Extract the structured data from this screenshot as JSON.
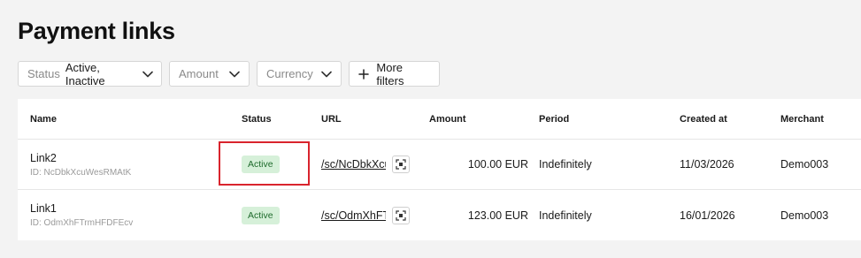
{
  "page": {
    "title": "Payment links"
  },
  "filters": {
    "status": {
      "label": "Status",
      "value": "Active, Inactive",
      "icon": "chevron-down-icon"
    },
    "amount": {
      "label": "Amount",
      "icon": "chevron-down-icon"
    },
    "currency": {
      "label": "Currency",
      "icon": "chevron-down-icon"
    },
    "more": {
      "label": "More filters",
      "icon": "plus-icon"
    }
  },
  "table": {
    "headers": {
      "name": "Name",
      "status": "Status",
      "url": "URL",
      "amount": "Amount",
      "period": "Period",
      "created": "Created at",
      "merchant": "Merchant"
    },
    "rows": [
      {
        "name": "Link2",
        "id": "ID: NcDbkXcuWesRMAtK",
        "status": "Active",
        "url": "/sc/NcDbkXcuWesRMAtK",
        "amount": "100.00 EUR",
        "period": "Indefinitely",
        "created": "11/03/2026",
        "merchant": "Demo003"
      },
      {
        "name": "Link1",
        "id": "ID: OdmXhFTrmHFDFEcv",
        "status": "Active",
        "url": "/sc/OdmXhFTrmHFDFEcv",
        "amount": "123.00 EUR",
        "period": "Indefinitely",
        "created": "16/01/2026",
        "merchant": "Demo003"
      }
    ]
  },
  "colors": {
    "highlight": "#d9242d",
    "badge_bg": "#d6f0d9",
    "badge_text": "#1f6b2c"
  }
}
